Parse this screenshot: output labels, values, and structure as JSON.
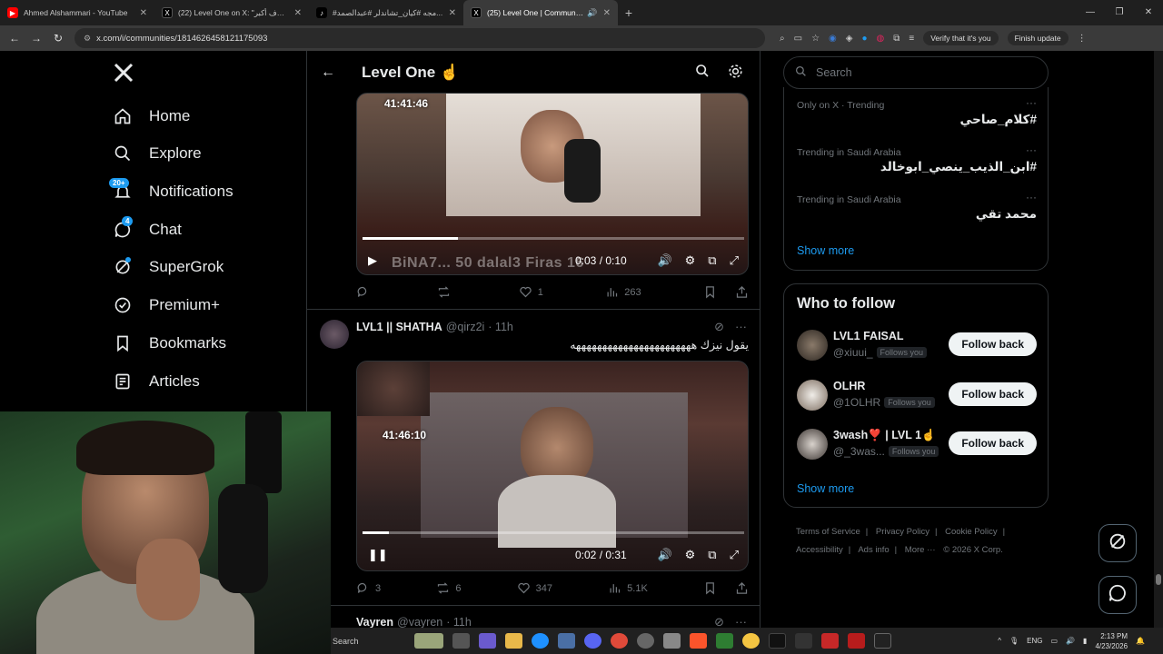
{
  "browser": {
    "tabs": [
      {
        "title": "Ahmed Alshammari - YouTube",
        "fav_color": "#ff0000",
        "fav": "▶",
        "active": false
      },
      {
        "title": "(22) Level One on X: \"الهدف أكبر\"",
        "fav_color": "#000000",
        "fav": "X",
        "active": false
      },
      {
        "title": "#مجه #كيان_تشاندلر #عبدالصمد...",
        "fav_color": "#000000",
        "fav": "♪",
        "active": false
      },
      {
        "title": "(25) Level One | Communi...",
        "fav_color": "#000000",
        "fav": "X",
        "active": true
      }
    ],
    "new_tab": "+",
    "url": "x.com/i/communities/1814626458121175093",
    "verify_label": "Verify that it's you",
    "finish_update": "Finish update"
  },
  "nav": {
    "items": [
      {
        "label": "Home",
        "icon": "home-icon"
      },
      {
        "label": "Explore",
        "icon": "search-icon"
      },
      {
        "label": "Notifications",
        "icon": "bell-icon",
        "badge": "20+"
      },
      {
        "label": "Chat",
        "icon": "chat-icon",
        "badge": "4"
      },
      {
        "label": "SuperGrok",
        "icon": "grok-icon"
      },
      {
        "label": "Premium+",
        "icon": "verified-icon"
      },
      {
        "label": "Bookmarks",
        "icon": "bookmark-icon"
      },
      {
        "label": "Articles",
        "icon": "article-icon"
      }
    ]
  },
  "main": {
    "title": "Level One ☝️",
    "video1": {
      "timestamp": "41:41:46",
      "time": "0:03 / 0:10",
      "overlay": "BiNA7...   50   dalal3        Firas   16",
      "progress": 0.25
    },
    "post1_actions": {
      "reply": "",
      "repost": "",
      "like": "1",
      "views": "263"
    },
    "post2": {
      "name": "LVL1 || SHATHA",
      "handle": "@qirz2i",
      "time": "· 11h",
      "text": "يقول نيزك هههههههههههههههههههههههه",
      "video": {
        "timestamp": "41:46:10",
        "time": "0:02 / 0:31",
        "progress": 0.07
      },
      "actions": {
        "reply": "3",
        "repost": "6",
        "like": "347",
        "views": "5.1K"
      }
    },
    "post3": {
      "name": "Vayren",
      "handle": "@vayren",
      "time": "· 11h"
    }
  },
  "right": {
    "search_placeholder": "Search",
    "trends": [
      {
        "context": "Only on X · Trending",
        "title": "#كلام_صاحي"
      },
      {
        "context": "Trending in Saudi Arabia",
        "title": "#ابن_الذيب_ينصي_ابوخالد"
      },
      {
        "context": "Trending in Saudi Arabia",
        "title": "محمد تقي"
      }
    ],
    "show_more": "Show more",
    "who_to_follow": {
      "title": "Who to follow",
      "accounts": [
        {
          "name": "LVL1 FAISAL",
          "handle": "@xiuui_",
          "follows_you": "Follows you",
          "button": "Follow back"
        },
        {
          "name": "OLHR",
          "handle": "@1OLHR",
          "follows_you": "Follows you",
          "button": "Follow back"
        },
        {
          "name": "3wash❣️ | LVL 1☝️",
          "handle": "@_3was...",
          "follows_you": "Follows you",
          "button": "Follow back"
        }
      ],
      "show_more": "Show more"
    },
    "footer": {
      "line1": [
        "Terms of Service",
        "|",
        "Privacy Policy",
        "|",
        "Cookie Policy",
        "|"
      ],
      "line2": [
        "Accessibility",
        "|",
        "Ads info",
        "|",
        "More ···",
        "© 2026 X Corp."
      ]
    }
  },
  "taskbar": {
    "search": "Search",
    "lang": "ENG",
    "time": "2:13 PM",
    "date": "4/23/2026"
  },
  "colors": {
    "accent": "#1d9bf0",
    "bg": "#000000",
    "border": "#2f3336",
    "muted": "#71767b"
  }
}
